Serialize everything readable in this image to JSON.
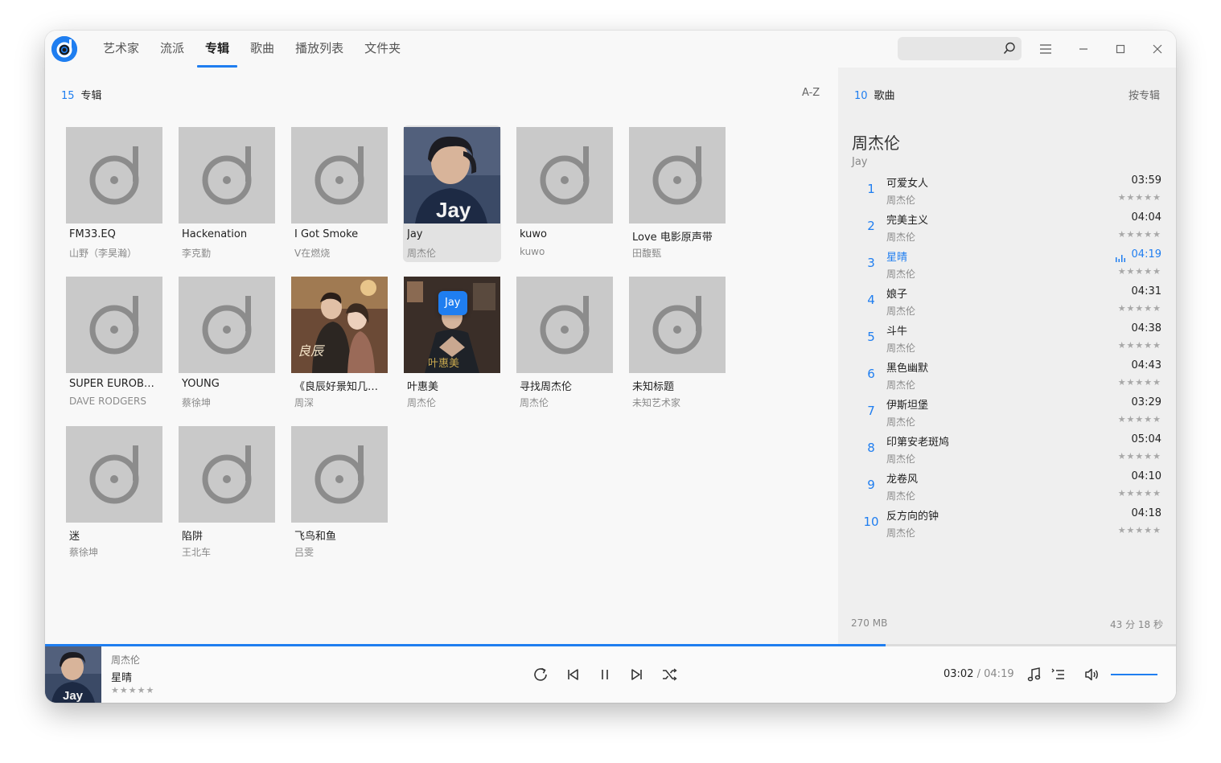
{
  "app": {
    "nav_tabs": [
      {
        "label": "艺术家"
      },
      {
        "label": "流派"
      },
      {
        "label": "专辑"
      },
      {
        "label": "歌曲"
      },
      {
        "label": "播放列表"
      },
      {
        "label": "文件夹"
      }
    ],
    "active_tab": "专辑",
    "search": {
      "value": "",
      "placeholder": ""
    },
    "accent_color": "#1f7ef0"
  },
  "albums_pane": {
    "count": "15",
    "label": "专辑",
    "sort_label": "A-Z",
    "tooltip": "Jay",
    "albums": [
      {
        "name": "FM33.EQ",
        "artist": "山野（李昊瀚）",
        "cover": "default"
      },
      {
        "name": "Hackenation",
        "artist": "李克勤",
        "cover": "default"
      },
      {
        "name": "I Got Smoke",
        "artist": "V在燃烧",
        "cover": "default"
      },
      {
        "name": "Jay",
        "artist": "周杰伦",
        "cover": "jay"
      },
      {
        "name": "kuwo",
        "artist": "kuwo",
        "cover": "default"
      },
      {
        "name": "Love 电影原声带",
        "artist": "田馥甄",
        "cover": "default"
      },
      {
        "name": "SUPER EUROBEAT...",
        "artist": "DAVE RODGERS",
        "cover": "default"
      },
      {
        "name": "YOUNG",
        "artist": "蔡徐坤",
        "cover": "default"
      },
      {
        "name": "《良辰好景知几何...",
        "artist": "周深",
        "cover": "drama"
      },
      {
        "name": "叶惠美",
        "artist": "周杰伦",
        "cover": "yehuimei"
      },
      {
        "name": "寻找周杰伦",
        "artist": "周杰伦",
        "cover": "default"
      },
      {
        "name": "未知标题",
        "artist": "未知艺术家",
        "cover": "default"
      },
      {
        "name": "迷",
        "artist": "蔡徐坤",
        "cover": "default"
      },
      {
        "name": "陷阱",
        "artist": "王北车",
        "cover": "default"
      },
      {
        "name": "飞鸟和鱼",
        "artist": "吕雯",
        "cover": "default"
      }
    ]
  },
  "songs_pane": {
    "count": "10",
    "label": "歌曲",
    "sort_label": "按专辑",
    "artist": "周杰伦",
    "album": "Jay",
    "songs": [
      {
        "num": "1",
        "title": "可爱女人",
        "singer": "周杰伦",
        "duration": "03:59",
        "stars": "★★★★★"
      },
      {
        "num": "2",
        "title": "完美主义",
        "singer": "周杰伦",
        "duration": "04:04",
        "stars": "★★★★★"
      },
      {
        "num": "3",
        "title": "星晴",
        "singer": "周杰伦",
        "duration": "04:19",
        "stars": "★★★★★",
        "playing": true
      },
      {
        "num": "4",
        "title": "娘子",
        "singer": "周杰伦",
        "duration": "04:31",
        "stars": "★★★★★"
      },
      {
        "num": "5",
        "title": "斗牛",
        "singer": "周杰伦",
        "duration": "04:38",
        "stars": "★★★★★"
      },
      {
        "num": "6",
        "title": "黑色幽默",
        "singer": "周杰伦",
        "duration": "04:43",
        "stars": "★★★★★"
      },
      {
        "num": "7",
        "title": "伊斯坦堡",
        "singer": "周杰伦",
        "duration": "03:29",
        "stars": "★★★★★"
      },
      {
        "num": "8",
        "title": "印第安老斑鸠",
        "singer": "周杰伦",
        "duration": "05:04",
        "stars": "★★★★★"
      },
      {
        "num": "9",
        "title": "龙卷风",
        "singer": "周杰伦",
        "duration": "04:10",
        "stars": "★★★★★"
      },
      {
        "num": "10",
        "title": "反方向的钟",
        "singer": "周杰伦",
        "duration": "04:18",
        "stars": "★★★★★"
      }
    ],
    "size": "270 MB",
    "total_time": "43 分 18 秒"
  },
  "player": {
    "artist": "周杰伦",
    "title": "星晴",
    "stars": "★★★★★",
    "current_time": "03:02",
    "separator": "/",
    "total_time": "04:19",
    "progress": 0.743,
    "volume": 1.0
  }
}
